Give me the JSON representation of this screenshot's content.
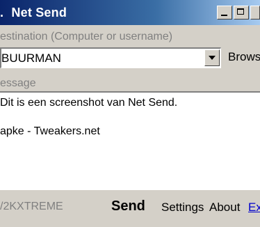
{
  "window": {
    "title": "Net Send",
    "title_prefix": "."
  },
  "destination": {
    "label": "estination (Computer or username)",
    "value": "BUURMAN",
    "browse_label": "Browse"
  },
  "message": {
    "label": "essage",
    "lines": [
      "Dit is een screenshot van Net Send.",
      "apke - Tweakers.net"
    ]
  },
  "footer": {
    "brand": "/2KXTREME",
    "send_label": "Send",
    "settings_label": "Settings",
    "about_label": "About",
    "exit_label": "Ex"
  },
  "colors": {
    "titlebar_start": "#0a246a",
    "titlebar_end": "#a6caf0",
    "face": "#d4d0c8",
    "muted_text": "#808080",
    "link": "#0000cc"
  },
  "icons": [
    "app-icon",
    "minimize-icon",
    "maximize-icon",
    "dropdown-arrow-icon"
  ]
}
